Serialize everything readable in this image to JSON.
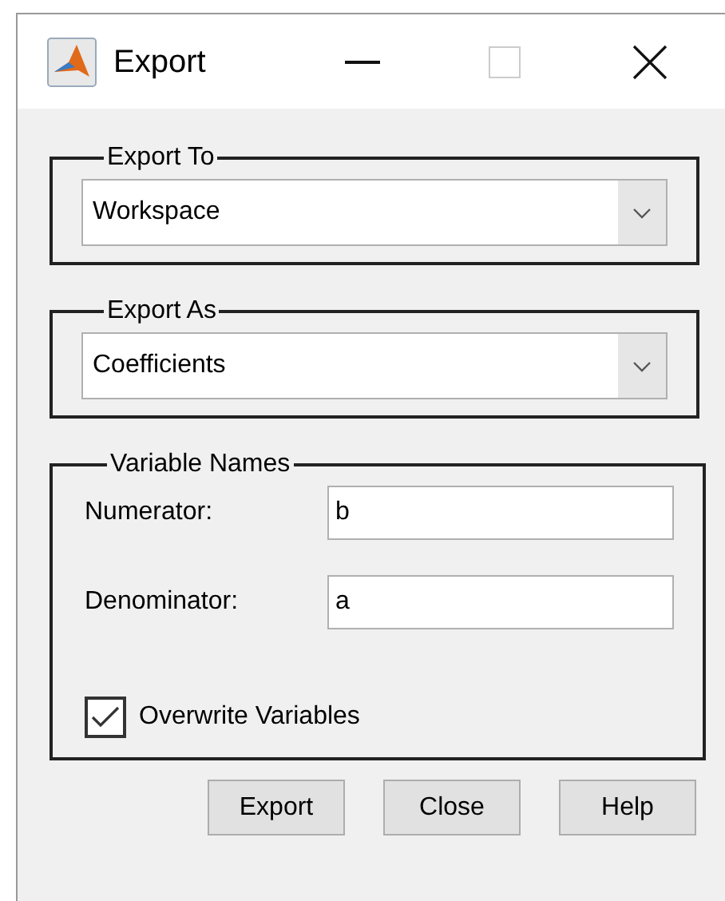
{
  "window": {
    "title": "Export"
  },
  "groups": [
    {
      "kind": "dropdown",
      "legend": "Export To",
      "value": "Workspace"
    },
    {
      "kind": "dropdown",
      "legend": "Export As",
      "value": "Coefficients"
    },
    {
      "kind": "fields",
      "legend": "Variable Names",
      "fields": [
        {
          "label": "Numerator:",
          "value": "b"
        },
        {
          "label": "Denominator:",
          "value": "a"
        }
      ],
      "checkbox": {
        "label": "Overwrite Variables",
        "checked": true
      }
    }
  ],
  "buttons": [
    "Export",
    "Close",
    "Help"
  ]
}
